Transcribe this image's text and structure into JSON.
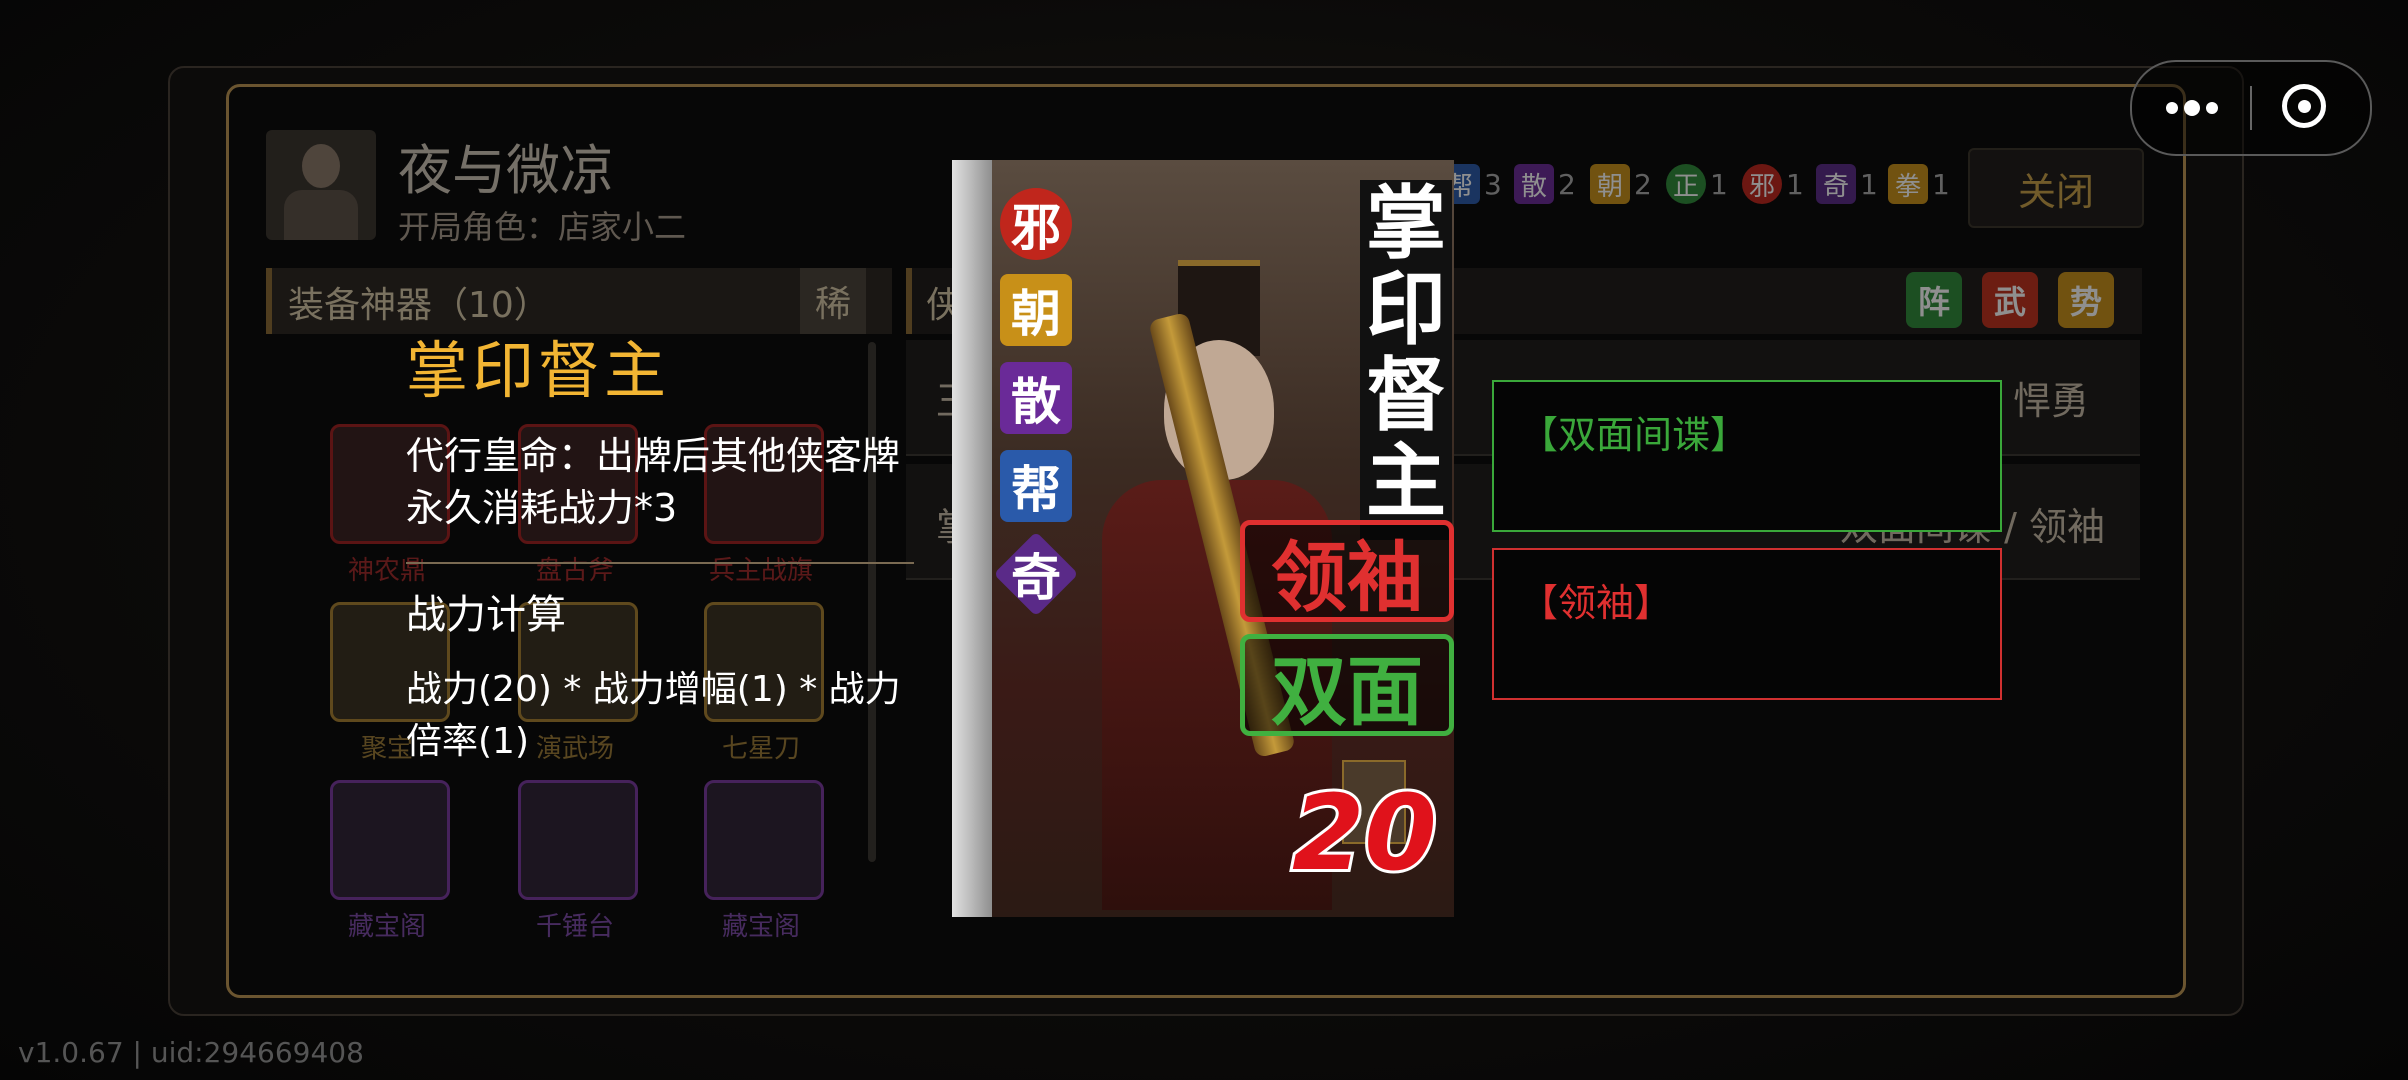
{
  "player": {
    "name": "夜与微凉",
    "start_role": "开局角色：店家小二"
  },
  "close_label": "关闭",
  "equip": {
    "title": "装备神器（10）",
    "sort_label": "稀",
    "items": [
      {
        "label": "神农鼎",
        "rarity": "red"
      },
      {
        "label": "盘古斧",
        "rarity": "red"
      },
      {
        "label": "兵主战旗",
        "rarity": "red"
      },
      {
        "label": "聚宝",
        "rarity": "gold"
      },
      {
        "label": "演武场",
        "rarity": "gold"
      },
      {
        "label": "七星刀",
        "rarity": "gold"
      },
      {
        "label": "藏宝阁",
        "rarity": "purple"
      },
      {
        "label": "千锤台",
        "rarity": "purple"
      },
      {
        "label": "藏宝阁",
        "rarity": "purple"
      }
    ]
  },
  "hero_panel": {
    "header_label": "侠",
    "tags": [
      {
        "label": "阵",
        "color": "#2f8a3a"
      },
      {
        "label": "武",
        "color": "#c0301c"
      },
      {
        "label": "势",
        "color": "#c89018"
      }
    ],
    "rows": [
      {
        "prefix": "王",
        "traits": "勇猛 / 悍勇"
      },
      {
        "prefix": "掌",
        "traits": "双面间谍 / 领袖"
      }
    ]
  },
  "stats": [
    {
      "label": "帮",
      "value": "3",
      "color": "#2a5aaa"
    },
    {
      "label": "散",
      "value": "2",
      "color": "#6a2a98"
    },
    {
      "label": "朝",
      "value": "2",
      "color": "#c89018"
    },
    {
      "label": "正",
      "value": "1",
      "color": "#2f8a3a"
    },
    {
      "label": "邪",
      "value": "1",
      "color": "#c0261c"
    },
    {
      "label": "奇",
      "value": "1",
      "color": "#5a2a88"
    },
    {
      "label": "拳",
      "value": "1",
      "color": "#c89018"
    }
  ],
  "popup": {
    "title": "掌印督主",
    "description": "代行皇命：出牌后其他侠客牌永久消耗战力*3",
    "calc_title": "战力计算",
    "formula": "战力(20) * 战力增幅(1) * 战力倍率(1)"
  },
  "card": {
    "name": "掌印督主",
    "factions": [
      "邪",
      "朝",
      "散",
      "帮",
      "奇"
    ],
    "trait_1": "领袖",
    "trait_2": "双面",
    "power": "20"
  },
  "keywords": [
    {
      "title": "【双面间谍】",
      "color": "#3aa83a"
    },
    {
      "title": "【领袖】",
      "color": "#e03030"
    }
  ],
  "version": "v1.0.67 | uid:294669408"
}
